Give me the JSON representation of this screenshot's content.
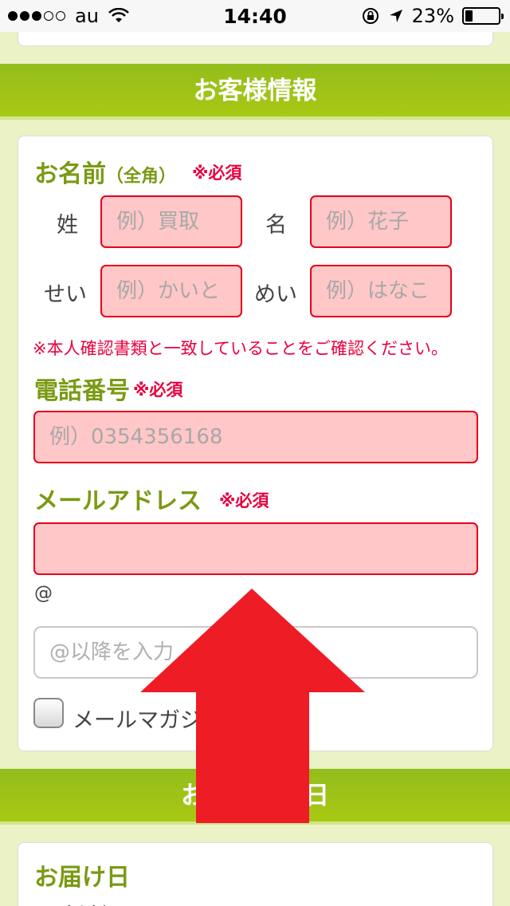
{
  "status_bar": {
    "carrier": "au",
    "time": "14:40",
    "battery": "23%",
    "battery_level": 0.23
  },
  "customer_section": {
    "header": "お客様情報",
    "name": {
      "title": "お名前",
      "sub": "（全角）",
      "required": "※必須",
      "sei_label": "姓",
      "mei_label": "名",
      "sei_placeholder": "例）買取",
      "mei_placeholder": "例）花子",
      "sei_kana_label": "せい",
      "mei_kana_label": "めい",
      "sei_kana_placeholder": "例）かいと",
      "mei_kana_placeholder": "例）はなこ",
      "note": "※本人確認書類と一致していることをご確認ください。"
    },
    "phone": {
      "title": "電話番号",
      "required": "※必須",
      "placeholder": "例）0354356168"
    },
    "email": {
      "title": "メールアドレス",
      "required": "※必須",
      "value": "",
      "at": "@",
      "domain_placeholder": "@以降を入力"
    },
    "newsletter": {
      "label": "メールマガジ"
    }
  },
  "delivery_section": {
    "header": "お届け希望日",
    "date_title": "お届け日",
    "partial_text": "配達希望日"
  },
  "colors": {
    "header_green": "#9fc21a",
    "label_green": "#7a9a13",
    "required_red": "#e8003e",
    "arrow_red": "#ee1c25",
    "input_pink": "#ffc7c7"
  }
}
